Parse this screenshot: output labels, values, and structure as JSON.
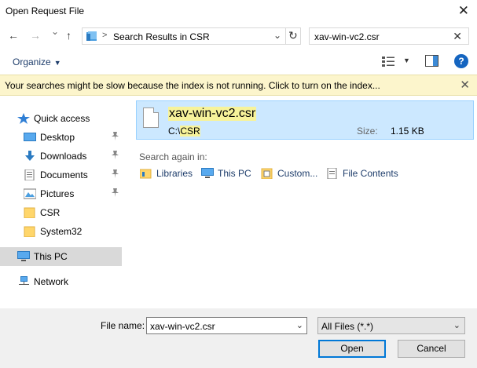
{
  "window": {
    "title": "Open Request File",
    "close_glyph": "✕"
  },
  "nav": {
    "back_glyph": "←",
    "forward_glyph": "→",
    "recent_glyph": "⌄",
    "up_glyph": "↑"
  },
  "address": {
    "separator_glyph": ">",
    "path_text": "Search Results in CSR",
    "dropdown_glyph": "⌄",
    "refresh_glyph": "↻"
  },
  "search": {
    "value": "xav-win-vc2.csr",
    "clear_glyph": "✕"
  },
  "toolbar": {
    "organize_label": "Organize",
    "organize_arrow": "▼",
    "view_arrow": "▼",
    "help_glyph": "?"
  },
  "infobar": {
    "message": "Your searches might be slow because the index is not running.  Click to turn on the index...",
    "close_glyph": "✕"
  },
  "sidebar": {
    "items": [
      {
        "label": "Quick access",
        "icon": "star-icon",
        "pinned": false
      },
      {
        "label": "Desktop",
        "icon": "desktop-icon",
        "pinned": true
      },
      {
        "label": "Downloads",
        "icon": "download-icon",
        "pinned": true
      },
      {
        "label": "Documents",
        "icon": "documents-icon",
        "pinned": true
      },
      {
        "label": "Pictures",
        "icon": "pictures-icon",
        "pinned": true
      },
      {
        "label": "CSR",
        "icon": "folder-icon",
        "pinned": false
      },
      {
        "label": "System32",
        "icon": "folder-icon",
        "pinned": false
      },
      {
        "label": "This PC",
        "icon": "computer-icon",
        "pinned": false,
        "selected": true
      },
      {
        "label": "Network",
        "icon": "network-icon",
        "pinned": false
      }
    ],
    "pin_glyph": "📌"
  },
  "results": {
    "items": [
      {
        "name": "xav-win-vc2.csr",
        "path_prefix": "C:\\",
        "path_highlight": "CSR",
        "size_label": "Size:",
        "size_value": "1.15 KB"
      }
    ],
    "search_again_label": "Search again in:",
    "search_again_items": [
      {
        "label": "Libraries",
        "icon": "libraries-icon"
      },
      {
        "label": "This PC",
        "icon": "computer-icon"
      },
      {
        "label": "Custom...",
        "icon": "custom-folder-icon"
      },
      {
        "label": "File Contents",
        "icon": "file-contents-icon"
      }
    ]
  },
  "footer": {
    "filename_label": "File name:",
    "filename_value": "xav-win-vc2.csr",
    "filename_dropdown_glyph": "⌄",
    "filter_value": "All Files (*.*)",
    "filter_dropdown_glyph": "⌄",
    "open_label": "Open",
    "cancel_label": "Cancel"
  },
  "colors": {
    "selection_bg": "#cce8ff",
    "highlight": "#f7f39a",
    "infobar_bg": "#fcf5cc",
    "accent": "#0078d7"
  }
}
